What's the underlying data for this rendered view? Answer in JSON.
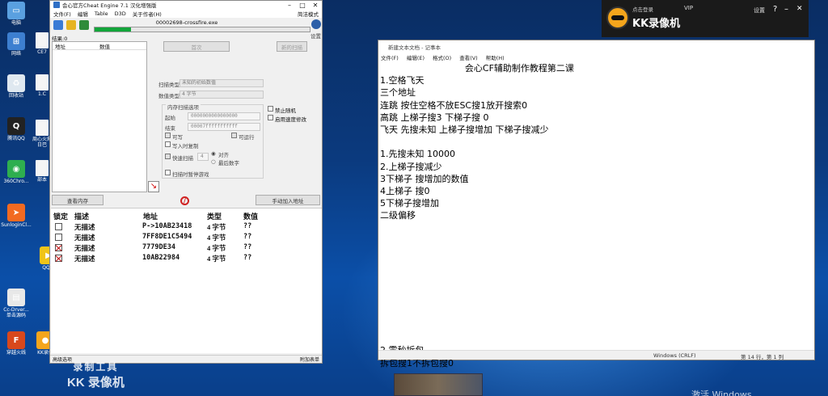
{
  "desktop": {
    "icons": [
      {
        "label": "电脑",
        "color": "#5aa0e0",
        "glyph": "▭"
      },
      {
        "label": "网络",
        "color": "#3d7fd0",
        "glyph": "⊞"
      },
      {
        "label": "回收站",
        "color": "#dfe8f0",
        "glyph": "♻"
      },
      {
        "label": "腾讯QQ",
        "color": "#222222",
        "glyph": "Q"
      },
      {
        "label": "360Chro...",
        "color": "#2eae4f",
        "glyph": "◉"
      },
      {
        "label": "SunloginCl...",
        "color": "#f26a21",
        "glyph": "➤"
      },
      {
        "label": "QQ影",
        "color": "#f0c419",
        "glyph": "▶"
      },
      {
        "label": "Cc-Drver...\n单击源码",
        "color": "#e8e8e8",
        "glyph": "▤"
      },
      {
        "label": "穿越火线",
        "color": "#d8481c",
        "glyph": "F"
      },
      {
        "label": "KK录像",
        "color": "#f4a51c",
        "glyph": "●"
      }
    ],
    "icons_col2": [
      {
        "label": "CE7"
      },
      {
        "label": "1.C"
      },
      {
        "label": "周心火爆\n日巴"
      },
      {
        "label": "部本"
      }
    ],
    "watermark_line1": "录制工具",
    "watermark_line2": "KK 录像机",
    "activate_text": "激活 Windows"
  },
  "cheat_engine": {
    "title": "会心官方Cheat Engine 7.1 汉化增强版",
    "menu": [
      "文件(F)",
      "编辑",
      "Table",
      "D3D",
      "关于作者(H)"
    ],
    "menu_right": "简洁模式",
    "process_name": "00002698-crossfire.exe",
    "settings_label": "设置",
    "progress_fraction": 0.17,
    "results_label": "结果:0",
    "list_columns": [
      "地址",
      "数值"
    ],
    "buttons": {
      "first_scan": "首次",
      "next_scan": "新的扫描",
      "view_memory": "查看内存",
      "add_address": "手动加入地址"
    },
    "scan_type_label": "扫描类型",
    "scan_type_value": "未知的初始数值",
    "value_type_label": "数值类型",
    "value_type_value": "4 字节",
    "memory_options_label": "内存扫描选项",
    "start_label": "起始",
    "start_value": "0000000000000000",
    "stop_label": "结束",
    "stop_value": "00007fffffffffff",
    "writable": "可写",
    "executable": "可运行",
    "copy_on_write": "写入时复制",
    "fast_scan": "快速扫描",
    "fast_scan_value": "4",
    "align": "对齐",
    "last_digits": "最后数字",
    "pause_game": "扫描时暂停游戏",
    "disable_random": "禁止随机",
    "enable_speedhack": "启用速度修改",
    "table_headers": [
      "锁定",
      "描述",
      "地址",
      "类型",
      "数值"
    ],
    "table_rows": [
      {
        "active": false,
        "desc": "无描述",
        "address": "P->10AB23418",
        "type": "4 字节",
        "value": "??"
      },
      {
        "active": false,
        "desc": "无描述",
        "address": "7FF8DE1C5494",
        "type": "4 字节",
        "value": "??"
      },
      {
        "active": true,
        "desc": "无描述",
        "address": "7779DE34",
        "type": "4 字节",
        "value": "??"
      },
      {
        "active": true,
        "desc": "无描述",
        "address": "10AB22984",
        "type": "4 字节",
        "value": "??"
      }
    ],
    "status_left": "高级选项",
    "status_right": "附加表单"
  },
  "notepad": {
    "title": "新建文本文档 - 记事本",
    "menu": [
      "文件(F)",
      "编辑(E)",
      "格式(O)",
      "查看(V)",
      "帮助(H)"
    ],
    "lines": [
      "                              会心CF辅助制作教程第二课",
      "1.空格飞天",
      "三个地址",
      "连跳 按住空格不放ESC搜1放开搜索0",
      "高跳 上梯子搜3 下梯子搜 0",
      "飞天 先搜未知 上梯子搜增加 下梯子搜减少",
      "",
      "1.先搜未知 10000",
      "2.上梯子搜减少",
      "3下梯子 搜增加的数值",
      "4上梯子 搜0",
      "5下梯子搜增加",
      "二级偏移",
      "",
      "",
      "",
      "",
      "",
      "",
      "",
      "",
      "",
      "",
      "2.零秒拆包",
      "拆包搜1不拆包搜0"
    ],
    "status_encoding": "Windows (CRLF)",
    "status_position": "第 14 行，第 1 列"
  },
  "kk_recorder": {
    "login": "点击登录",
    "name": "KK录像机",
    "vip": "VIP",
    "settings": "设置",
    "help": "?",
    "minimize": "–",
    "close": "✕"
  }
}
